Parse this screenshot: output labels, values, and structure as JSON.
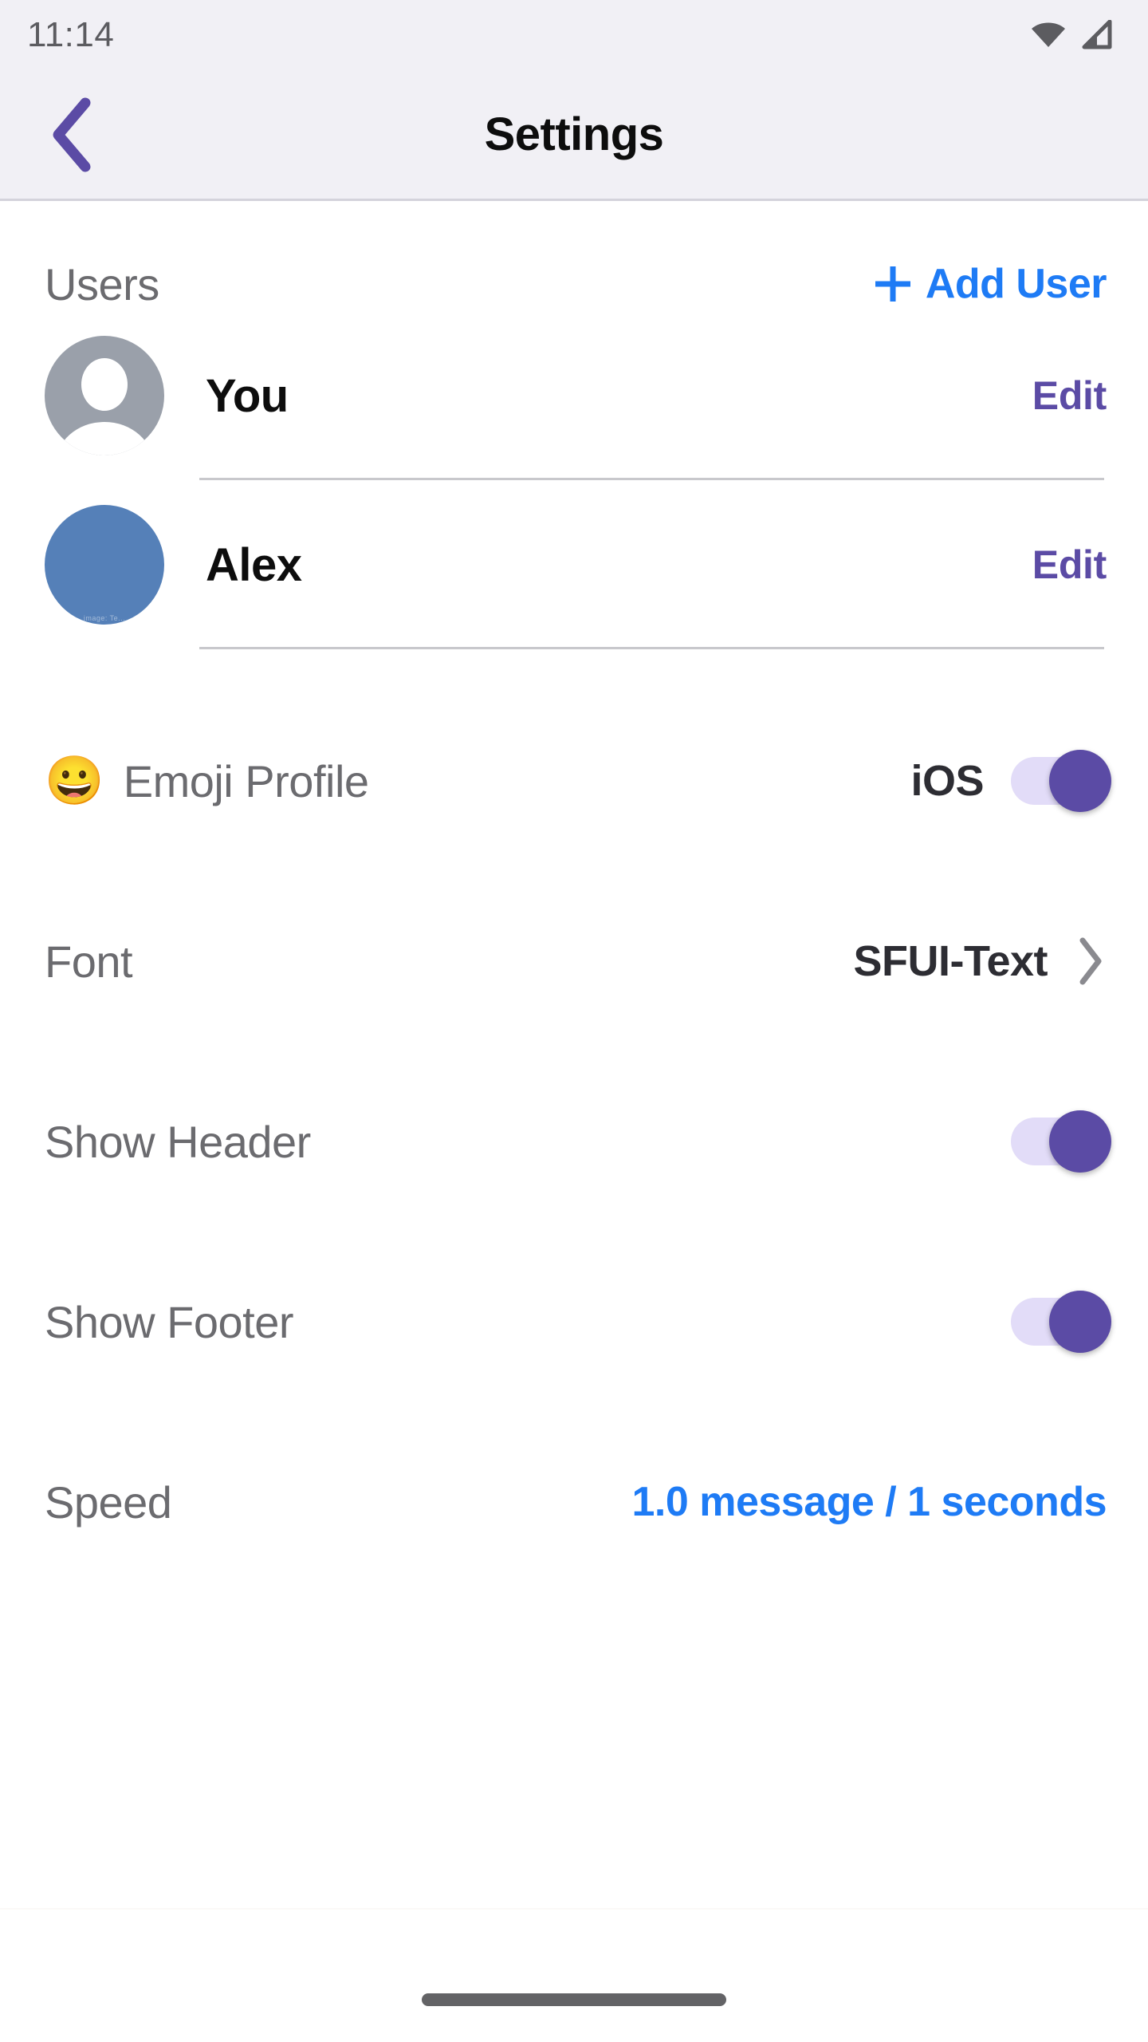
{
  "statusbar": {
    "time": "11:14",
    "wifi_icon": "wifi-icon",
    "cellular_icon": "cellular-signal-icon"
  },
  "appbar": {
    "back_icon": "chevron-left-icon",
    "title": "Settings",
    "accent_color": "#5B4BA5",
    "background_color": "#F1F0F5"
  },
  "users_section": {
    "title": "Users",
    "add_user": {
      "label": "Add User",
      "icon": "plus-icon",
      "color": "#1E7BF5"
    },
    "rows": [
      {
        "name": "You",
        "avatar_type": "generic-person",
        "avatar_color": "#9AA0AA",
        "action_label": "Edit",
        "action_color": "#5B4BA5",
        "watermark": ""
      },
      {
        "name": "Alex",
        "avatar_type": "solid-color",
        "avatar_color": "#5580B8",
        "action_label": "Edit",
        "action_color": "#5B4BA5",
        "watermark": "image: Te..."
      }
    ]
  },
  "settings": {
    "emoji_profile": {
      "emoji": "😀",
      "label": "Emoji Profile",
      "value": "iOS",
      "toggle_on": true,
      "toggle_color": "#5B4BA5",
      "track_color": "#E2DCF8"
    },
    "font": {
      "label": "Font",
      "value": "SFUI-Text",
      "chevron_icon": "chevron-right-icon"
    },
    "show_header": {
      "label": "Show Header",
      "toggle_on": true,
      "toggle_color": "#5B4BA5",
      "track_color": "#E2DCF8"
    },
    "show_footer": {
      "label": "Show Footer",
      "toggle_on": true,
      "toggle_color": "#5B4BA5",
      "track_color": "#E2DCF8"
    },
    "speed": {
      "label": "Speed",
      "value": "1.0 message / 1 seconds",
      "value_color": "#1E7BF5"
    }
  },
  "bottom": {
    "home_indicator": "home-indicator"
  }
}
